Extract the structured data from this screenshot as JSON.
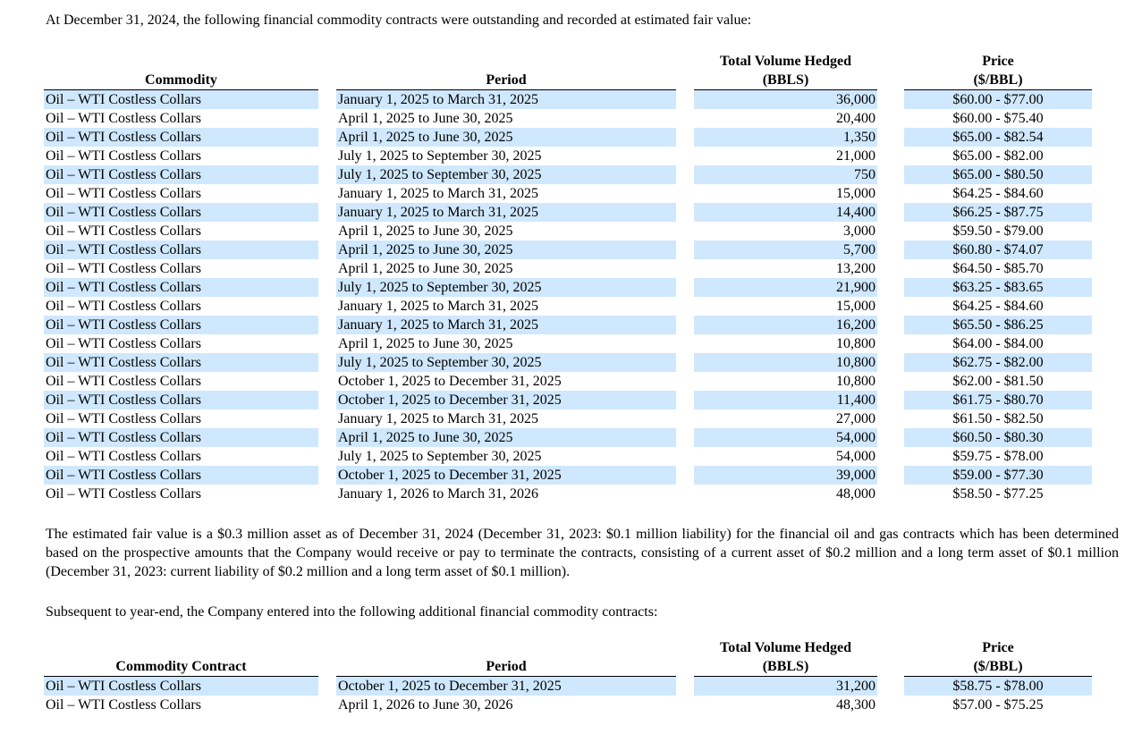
{
  "intro_text": "At December 31, 2024, the following financial commodity contracts were outstanding and recorded at estimated fair value:",
  "table1": {
    "headers": {
      "commodity": "Commodity",
      "period": "Period",
      "volume_line1": "Total Volume Hedged",
      "volume_line2": "(BBLS)",
      "price_line1": "Price",
      "price_line2": "($/BBL)"
    },
    "rows": [
      {
        "commodity": "Oil – WTI Costless Collars",
        "period": "January 1, 2025 to March 31, 2025",
        "volume": "36,000",
        "price": "$60.00 - $77.00"
      },
      {
        "commodity": "Oil – WTI Costless Collars",
        "period": "April 1, 2025 to June 30, 2025",
        "volume": "20,400",
        "price": "$60.00 - $75.40"
      },
      {
        "commodity": "Oil – WTI Costless Collars",
        "period": "April 1, 2025 to June 30, 2025",
        "volume": "1,350",
        "price": "$65.00 - $82.54"
      },
      {
        "commodity": "Oil – WTI Costless Collars",
        "period": "July 1, 2025 to September 30, 2025",
        "volume": "21,000",
        "price": "$65.00 - $82.00"
      },
      {
        "commodity": "Oil – WTI Costless Collars",
        "period": "July 1, 2025 to September 30, 2025",
        "volume": "750",
        "price": "$65.00 - $80.50"
      },
      {
        "commodity": "Oil – WTI Costless Collars",
        "period": "January 1, 2025 to March 31, 2025",
        "volume": "15,000",
        "price": "$64.25 - $84.60"
      },
      {
        "commodity": "Oil – WTI Costless Collars",
        "period": "January 1, 2025 to March 31, 2025",
        "volume": "14,400",
        "price": "$66.25 - $87.75"
      },
      {
        "commodity": "Oil – WTI Costless Collars",
        "period": "April 1, 2025 to June 30, 2025",
        "volume": "3,000",
        "price": "$59.50 - $79.00"
      },
      {
        "commodity": "Oil – WTI Costless Collars",
        "period": "April 1, 2025 to June 30, 2025",
        "volume": "5,700",
        "price": "$60.80 - $74.07"
      },
      {
        "commodity": "Oil – WTI Costless Collars",
        "period": "April 1, 2025 to June 30, 2025",
        "volume": "13,200",
        "price": "$64.50 - $85.70"
      },
      {
        "commodity": "Oil – WTI Costless Collars",
        "period": "July 1, 2025 to September 30, 2025",
        "volume": "21,900",
        "price": "$63.25 - $83.65"
      },
      {
        "commodity": "Oil – WTI Costless Collars",
        "period": "January 1, 2025 to March 31, 2025",
        "volume": "15,000",
        "price": "$64.25 - $84.60"
      },
      {
        "commodity": "Oil – WTI Costless Collars",
        "period": "January 1, 2025 to March 31, 2025",
        "volume": "16,200",
        "price": "$65.50 - $86.25"
      },
      {
        "commodity": "Oil – WTI Costless Collars",
        "period": "April 1, 2025 to June 30, 2025",
        "volume": "10,800",
        "price": "$64.00 - $84.00"
      },
      {
        "commodity": "Oil – WTI Costless Collars",
        "period": "July 1, 2025 to September 30, 2025",
        "volume": "10,800",
        "price": "$62.75 - $82.00"
      },
      {
        "commodity": "Oil – WTI Costless Collars",
        "period": "October 1, 2025 to December 31, 2025",
        "volume": "10,800",
        "price": "$62.00 - $81.50"
      },
      {
        "commodity": "Oil – WTI Costless Collars",
        "period": "October 1, 2025 to December 31, 2025",
        "volume": "11,400",
        "price": "$61.75 - $80.70"
      },
      {
        "commodity": "Oil – WTI Costless Collars",
        "period": "January 1, 2025 to March 31, 2025",
        "volume": "27,000",
        "price": "$61.50 - $82.50"
      },
      {
        "commodity": "Oil – WTI Costless Collars",
        "period": "April 1, 2025 to June 30, 2025",
        "volume": "54,000",
        "price": "$60.50 - $80.30"
      },
      {
        "commodity": "Oil – WTI Costless Collars",
        "period": "July 1, 2025 to September 30, 2025",
        "volume": "54,000",
        "price": "$59.75 - $78.00"
      },
      {
        "commodity": "Oil – WTI Costless Collars",
        "period": "October 1, 2025 to December 31, 2025",
        "volume": "39,000",
        "price": "$59.00 - $77.30"
      },
      {
        "commodity": "Oil – WTI Costless Collars",
        "period": "January 1, 2026 to March 31, 2026",
        "volume": "48,000",
        "price": "$58.50 - $77.25"
      }
    ]
  },
  "fair_value_text": "The estimated fair value is a $0.3 million asset as of December 31, 2024 (December 31, 2023: $0.1 million liability) for the financial oil and gas contracts which has been determined based on the prospective amounts that the Company would receive or pay to terminate the contracts, consisting of a current asset of $0.2 million and a long term asset of $0.1 million (December 31, 2023: current liability of $0.2 million and a long term asset of $0.1 million).",
  "subsequent_text": "Subsequent to year-end, the Company entered into the following additional financial commodity contracts:",
  "table2": {
    "headers": {
      "commodity": "Commodity Contract",
      "period": "Period",
      "volume_line1": "Total Volume Hedged",
      "volume_line2": "(BBLS)",
      "price_line1": "Price",
      "price_line2": "($/BBL)"
    },
    "rows": [
      {
        "commodity": "Oil – WTI Costless Collars",
        "period": "October 1, 2025 to December 31, 2025",
        "volume": "31,200",
        "price": "$58.75 - $78.00"
      },
      {
        "commodity": "Oil – WTI Costless Collars",
        "period": "April 1, 2026 to June 30, 2026",
        "volume": "48,300",
        "price": "$57.00 - $75.25"
      }
    ]
  }
}
